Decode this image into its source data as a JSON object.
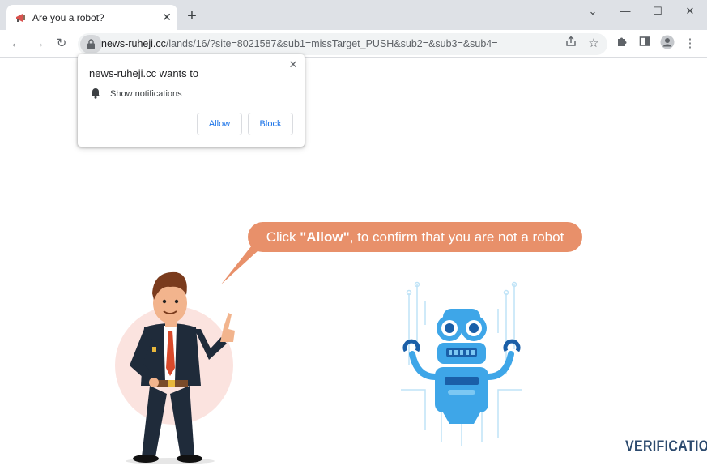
{
  "tab": {
    "title": "Are you a robot?"
  },
  "window_controls": {
    "dropdown": "⌄",
    "minimize": "—",
    "maximize": "☐",
    "close": "✕"
  },
  "address": {
    "host": "news-ruheji.cc",
    "path": "/lands/16/?site=8021587&sub1=missTarget_PUSH&sub2=&sub3=&sub4="
  },
  "prompt": {
    "title": "news-ruheji.cc wants to",
    "permission": "Show notifications",
    "allow_label": "Allow",
    "block_label": "Block"
  },
  "bubble": {
    "prefix": "Click ",
    "emphasis": "\"Allow\"",
    "suffix": ", to confirm that you are not a robot"
  },
  "watermark": "VERIFICATION",
  "colors": {
    "bubble": "#e8906a",
    "accent": "#1a73e8",
    "robot": "#3ea6e8",
    "watermark": "#2c4a6e"
  }
}
